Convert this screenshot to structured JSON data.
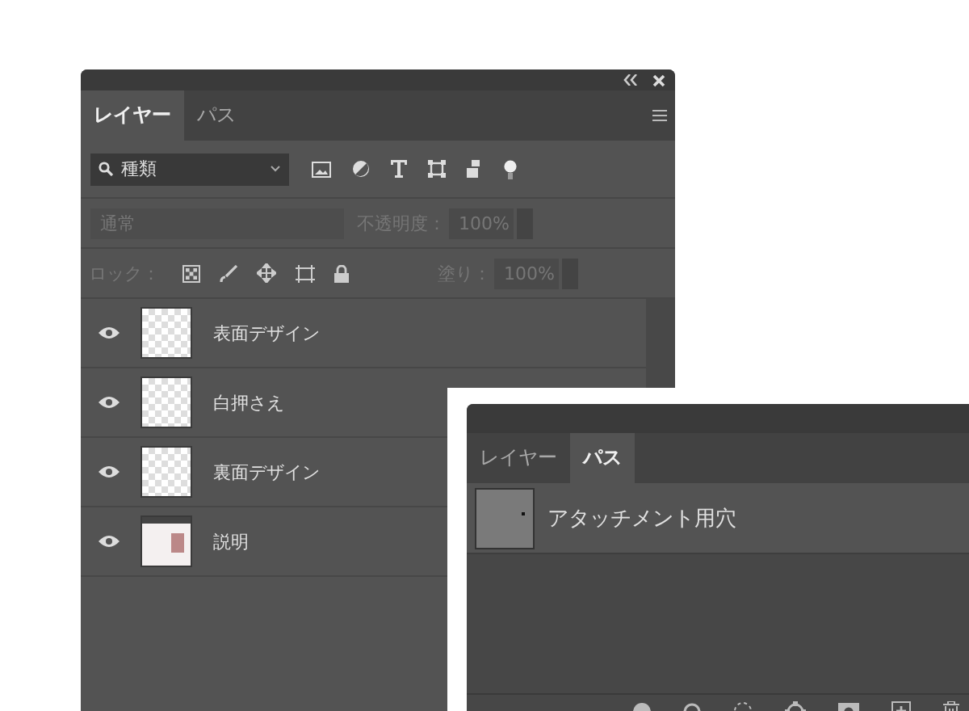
{
  "layers_panel": {
    "tabs": [
      {
        "label": "レイヤー",
        "selected": true
      },
      {
        "label": "パス",
        "selected": false
      }
    ],
    "filter": {
      "value": "種類"
    },
    "blend_mode": {
      "value": "通常",
      "disabled": true
    },
    "opacity": {
      "label": "不透明度：",
      "value": "100%",
      "disabled": true
    },
    "lock": {
      "label": "ロック："
    },
    "fill": {
      "label": "塗り：",
      "value": "100%",
      "disabled": true
    },
    "layers": [
      {
        "name": "表面デザイン",
        "visible": true,
        "kind": "transparent"
      },
      {
        "name": "白押さえ",
        "visible": true,
        "kind": "transparent"
      },
      {
        "name": "裏面デザイン",
        "visible": true,
        "kind": "transparent"
      },
      {
        "name": "説明",
        "visible": true,
        "kind": "image"
      }
    ]
  },
  "paths_panel": {
    "tabs": [
      {
        "label": "レイヤー",
        "selected": false
      },
      {
        "label": "パス",
        "selected": true
      }
    ],
    "paths": [
      {
        "name": "アタッチメント用穴"
      }
    ]
  }
}
